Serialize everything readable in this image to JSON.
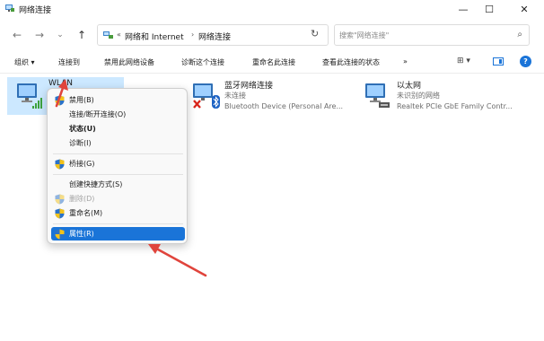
{
  "window": {
    "title": "网络连接"
  },
  "window_controls": {
    "minimize": "—",
    "maximize": "☐",
    "close": "✕"
  },
  "nav": {
    "back": "←",
    "forward": "→",
    "recent": "⌄",
    "up": "↑"
  },
  "address": {
    "crumbs": [
      "网络和 Internet",
      "网络连接"
    ],
    "separator_first": "«",
    "separator": "›",
    "dropdown": "⌄",
    "refresh": "↻"
  },
  "search": {
    "placeholder": "搜索\"网络连接\"",
    "icon": "⌕"
  },
  "commands": {
    "organize": "组织 ▾",
    "connect_to": "连接到",
    "disable_device": "禁用此网络设备",
    "diagnose": "诊断这个连接",
    "rename": "重命名此连接",
    "view_status": "查看此连接的状态",
    "more": "»",
    "view_options": "⊞ ▾",
    "help": "?"
  },
  "connections": [
    {
      "name": "WLAN",
      "status": "",
      "device": ""
    },
    {
      "name": "蓝牙网络连接",
      "status": "未连接",
      "device": "Bluetooth Device (Personal Are..."
    },
    {
      "name": "以太网",
      "status": "未识别的网络",
      "device": "Realtek PCIe GbE Family Contr..."
    }
  ],
  "context_menu": {
    "items": [
      {
        "label": "禁用(B)"
      },
      {
        "label": "连接/断开连接(O)"
      },
      {
        "label": "状态(U)"
      },
      {
        "label": "诊断(I)"
      },
      {
        "label": "桥接(G)"
      },
      {
        "label": "创建快捷方式(S)"
      },
      {
        "label": "删除(D)"
      },
      {
        "label": "重命名(M)"
      },
      {
        "label": "属性(R)"
      }
    ]
  },
  "colors": {
    "accent": "#1a74d8",
    "selection": "#cce8ff",
    "annotation_arrow": "#e0443c"
  }
}
